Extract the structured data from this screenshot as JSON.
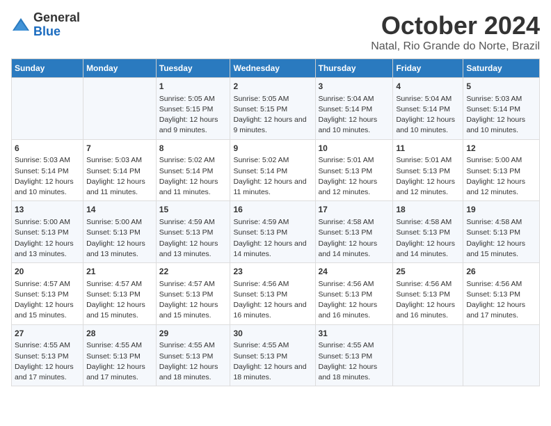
{
  "header": {
    "logo_line1": "General",
    "logo_line2": "Blue",
    "month": "October 2024",
    "location": "Natal, Rio Grande do Norte, Brazil"
  },
  "days_of_week": [
    "Sunday",
    "Monday",
    "Tuesday",
    "Wednesday",
    "Thursday",
    "Friday",
    "Saturday"
  ],
  "weeks": [
    [
      {
        "day": "",
        "info": ""
      },
      {
        "day": "",
        "info": ""
      },
      {
        "day": "1",
        "info": "Sunrise: 5:05 AM\nSunset: 5:15 PM\nDaylight: 12 hours and 9 minutes."
      },
      {
        "day": "2",
        "info": "Sunrise: 5:05 AM\nSunset: 5:15 PM\nDaylight: 12 hours and 9 minutes."
      },
      {
        "day": "3",
        "info": "Sunrise: 5:04 AM\nSunset: 5:14 PM\nDaylight: 12 hours and 10 minutes."
      },
      {
        "day": "4",
        "info": "Sunrise: 5:04 AM\nSunset: 5:14 PM\nDaylight: 12 hours and 10 minutes."
      },
      {
        "day": "5",
        "info": "Sunrise: 5:03 AM\nSunset: 5:14 PM\nDaylight: 12 hours and 10 minutes."
      }
    ],
    [
      {
        "day": "6",
        "info": "Sunrise: 5:03 AM\nSunset: 5:14 PM\nDaylight: 12 hours and 10 minutes."
      },
      {
        "day": "7",
        "info": "Sunrise: 5:03 AM\nSunset: 5:14 PM\nDaylight: 12 hours and 11 minutes."
      },
      {
        "day": "8",
        "info": "Sunrise: 5:02 AM\nSunset: 5:14 PM\nDaylight: 12 hours and 11 minutes."
      },
      {
        "day": "9",
        "info": "Sunrise: 5:02 AM\nSunset: 5:14 PM\nDaylight: 12 hours and 11 minutes."
      },
      {
        "day": "10",
        "info": "Sunrise: 5:01 AM\nSunset: 5:13 PM\nDaylight: 12 hours and 12 minutes."
      },
      {
        "day": "11",
        "info": "Sunrise: 5:01 AM\nSunset: 5:13 PM\nDaylight: 12 hours and 12 minutes."
      },
      {
        "day": "12",
        "info": "Sunrise: 5:00 AM\nSunset: 5:13 PM\nDaylight: 12 hours and 12 minutes."
      }
    ],
    [
      {
        "day": "13",
        "info": "Sunrise: 5:00 AM\nSunset: 5:13 PM\nDaylight: 12 hours and 13 minutes."
      },
      {
        "day": "14",
        "info": "Sunrise: 5:00 AM\nSunset: 5:13 PM\nDaylight: 12 hours and 13 minutes."
      },
      {
        "day": "15",
        "info": "Sunrise: 4:59 AM\nSunset: 5:13 PM\nDaylight: 12 hours and 13 minutes."
      },
      {
        "day": "16",
        "info": "Sunrise: 4:59 AM\nSunset: 5:13 PM\nDaylight: 12 hours and 14 minutes."
      },
      {
        "day": "17",
        "info": "Sunrise: 4:58 AM\nSunset: 5:13 PM\nDaylight: 12 hours and 14 minutes."
      },
      {
        "day": "18",
        "info": "Sunrise: 4:58 AM\nSunset: 5:13 PM\nDaylight: 12 hours and 14 minutes."
      },
      {
        "day": "19",
        "info": "Sunrise: 4:58 AM\nSunset: 5:13 PM\nDaylight: 12 hours and 15 minutes."
      }
    ],
    [
      {
        "day": "20",
        "info": "Sunrise: 4:57 AM\nSunset: 5:13 PM\nDaylight: 12 hours and 15 minutes."
      },
      {
        "day": "21",
        "info": "Sunrise: 4:57 AM\nSunset: 5:13 PM\nDaylight: 12 hours and 15 minutes."
      },
      {
        "day": "22",
        "info": "Sunrise: 4:57 AM\nSunset: 5:13 PM\nDaylight: 12 hours and 15 minutes."
      },
      {
        "day": "23",
        "info": "Sunrise: 4:56 AM\nSunset: 5:13 PM\nDaylight: 12 hours and 16 minutes."
      },
      {
        "day": "24",
        "info": "Sunrise: 4:56 AM\nSunset: 5:13 PM\nDaylight: 12 hours and 16 minutes."
      },
      {
        "day": "25",
        "info": "Sunrise: 4:56 AM\nSunset: 5:13 PM\nDaylight: 12 hours and 16 minutes."
      },
      {
        "day": "26",
        "info": "Sunrise: 4:56 AM\nSunset: 5:13 PM\nDaylight: 12 hours and 17 minutes."
      }
    ],
    [
      {
        "day": "27",
        "info": "Sunrise: 4:55 AM\nSunset: 5:13 PM\nDaylight: 12 hours and 17 minutes."
      },
      {
        "day": "28",
        "info": "Sunrise: 4:55 AM\nSunset: 5:13 PM\nDaylight: 12 hours and 17 minutes."
      },
      {
        "day": "29",
        "info": "Sunrise: 4:55 AM\nSunset: 5:13 PM\nDaylight: 12 hours and 18 minutes."
      },
      {
        "day": "30",
        "info": "Sunrise: 4:55 AM\nSunset: 5:13 PM\nDaylight: 12 hours and 18 minutes."
      },
      {
        "day": "31",
        "info": "Sunrise: 4:55 AM\nSunset: 5:13 PM\nDaylight: 12 hours and 18 minutes."
      },
      {
        "day": "",
        "info": ""
      },
      {
        "day": "",
        "info": ""
      }
    ]
  ]
}
